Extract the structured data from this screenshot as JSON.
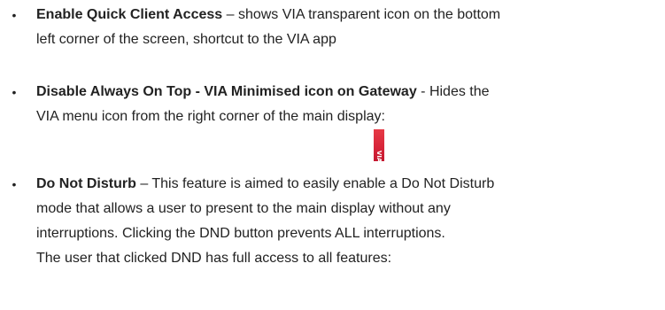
{
  "bullets": [
    {
      "term": "Enable Quick Client Access",
      "line1_rest": " – shows VIA transparent icon on the bottom",
      "line2": "left corner of the screen, shortcut to the VIA app"
    },
    {
      "term": "Disable Always On Top - VIA Minimised icon on Gateway",
      "line1_rest": "  - Hides the",
      "line2": "VIA menu icon from the right corner of the main display:",
      "icon": {
        "name": "via-minimised-icon",
        "label": "VIA",
        "color": "#d8263a"
      }
    },
    {
      "term": "Do Not Disturb",
      "line1_rest": " – This feature is aimed to easily enable a Do Not Disturb",
      "line2": "mode that allows a user to present to the main display without any",
      "line3": "interruptions. Clicking the DND button prevents ALL interruptions.",
      "line4": "The user that clicked DND has full access to all features:"
    }
  ]
}
